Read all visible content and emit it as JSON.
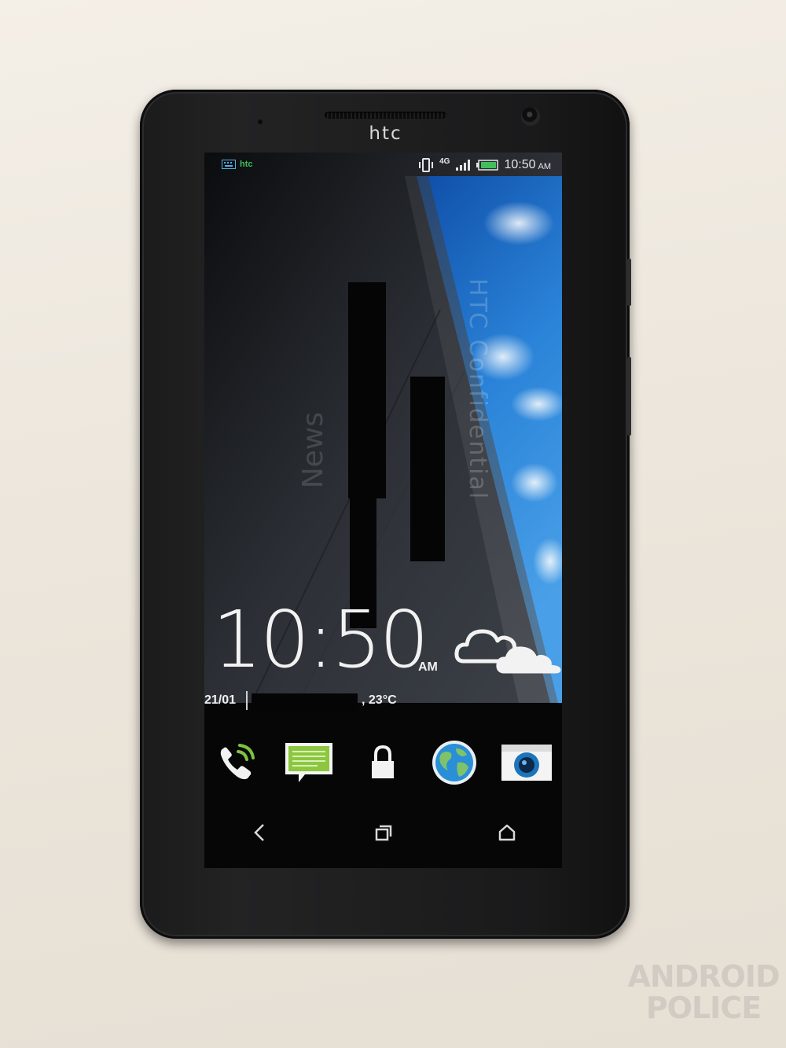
{
  "device": {
    "brand_logo": "htc"
  },
  "status_bar": {
    "app_icon": "keyboard-icon",
    "app_label": "htc",
    "icons": [
      "vibrate-icon",
      "signal-icon",
      "battery-icon"
    ],
    "network_label": "4G",
    "time": "10:50",
    "ampm": "AM",
    "battery_color": "#3fbf5a"
  },
  "wallpaper": {
    "side_text": "News",
    "watermark_text": "HTC Confidential",
    "sky_color": "#1e6fc8"
  },
  "lockscreen": {
    "clock_time": "10:50",
    "clock_ampm": "AM",
    "weather_icon": "cloudy-icon",
    "date": "21/01",
    "temperature": ", 23°C"
  },
  "dock": [
    {
      "name": "phone",
      "icon": "phone-icon",
      "accent": "#7cc242"
    },
    {
      "name": "messages",
      "icon": "messages-icon",
      "accent": "#8dc63f"
    },
    {
      "name": "lock",
      "icon": "lock-icon",
      "accent": "#ffffff"
    },
    {
      "name": "browser",
      "icon": "globe-icon",
      "accent": "#2a8fd6"
    },
    {
      "name": "camera",
      "icon": "camera-icon",
      "accent": "#1c75bc"
    }
  ],
  "nav_bar": [
    "back-icon",
    "recent-apps-icon",
    "home-icon"
  ],
  "photo_watermark": {
    "line1": "ANDROID",
    "line2": "POLICE"
  }
}
